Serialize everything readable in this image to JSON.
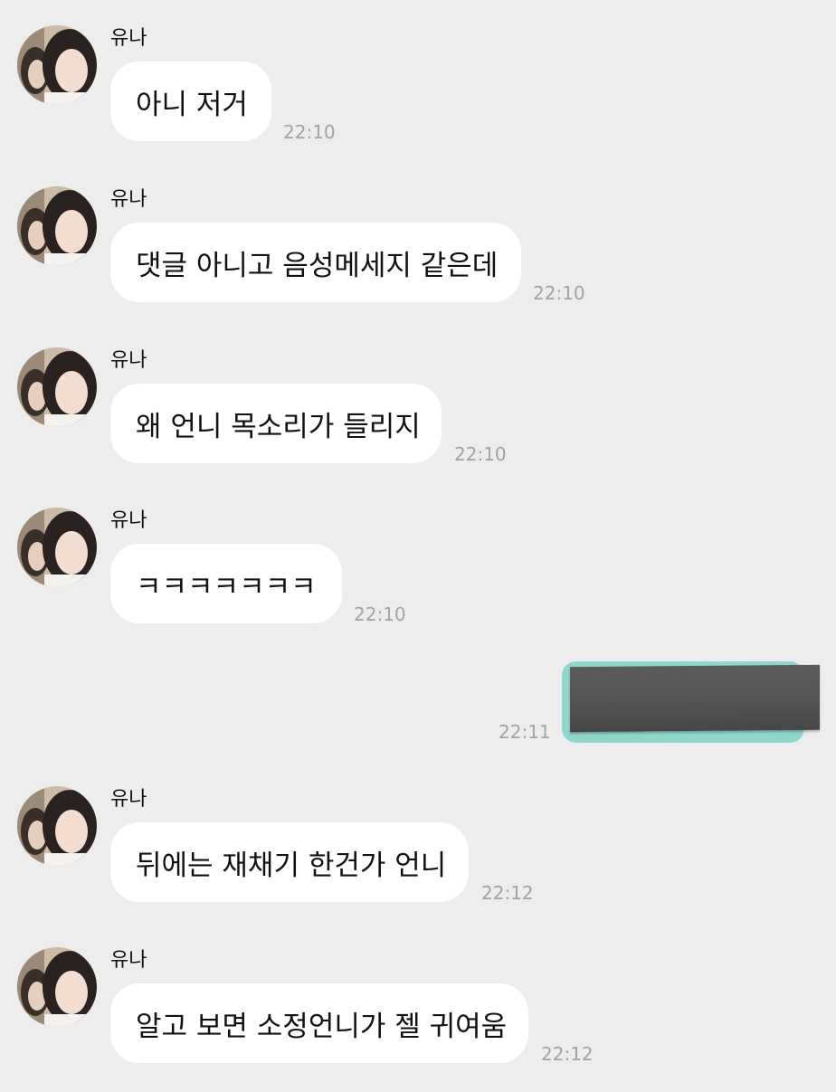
{
  "sender_name": "유나",
  "messages": [
    {
      "text": "아니 저거",
      "time": "22:10"
    },
    {
      "text": "댓글 아니고 음성메세지 같은데",
      "time": "22:10"
    },
    {
      "text": "왜 언니 목소리가 들리지",
      "time": "22:10"
    },
    {
      "text": "ㅋㅋㅋㅋㅋㅋㅋ",
      "time": "22:10"
    },
    {
      "text": "뒤에는 재채기 한건가 언니",
      "time": "22:12"
    },
    {
      "text": "알고 보면 소정언니가 젤 귀여움",
      "time": "22:12"
    }
  ],
  "sent_message": {
    "time": "22:11",
    "type": "image"
  },
  "colors": {
    "background": "#ededed",
    "bubble": "#ffffff",
    "timestamp": "#a3a3a3",
    "sent_card": "#8fd6cc"
  }
}
